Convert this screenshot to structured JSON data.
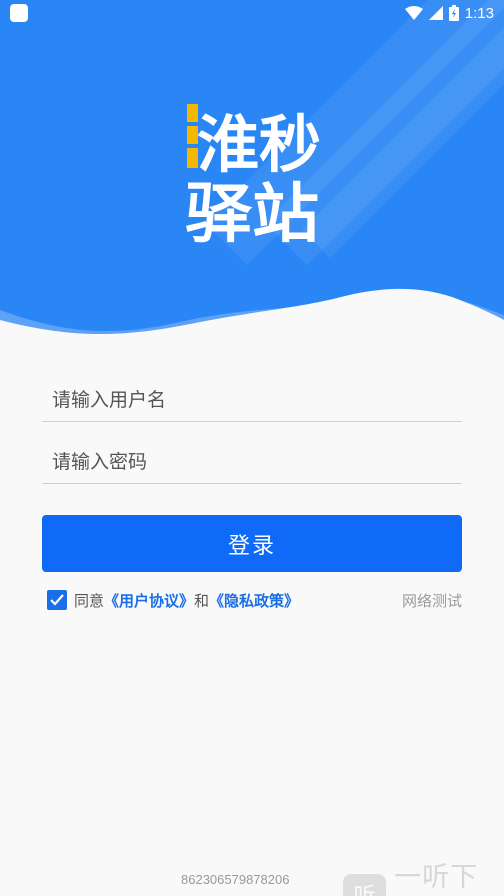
{
  "status_bar": {
    "time": "1:13",
    "icons": [
      "app-icon",
      "wifi-icon",
      "signal-icon",
      "battery-icon"
    ]
  },
  "logo": {
    "text_line1": "淮秒",
    "text_line2": "驿站",
    "accent_color": "#f5b800"
  },
  "form": {
    "username_placeholder": "请输入用户名",
    "password_placeholder": "请输入密码",
    "username_value": "",
    "password_value": ""
  },
  "login_button": {
    "label": "登录"
  },
  "agreement": {
    "checked": true,
    "prefix": "同意",
    "user_agreement": "《用户协议》",
    "and": "和",
    "privacy_policy": "《隐私政策》"
  },
  "network_test": {
    "label": "网络测试"
  },
  "device_id": "862306579878206",
  "watermark": {
    "icon_char": "听",
    "text": "一听下载"
  },
  "colors": {
    "header_blue": "#2b86f5",
    "button_blue": "#0f6bf7",
    "link_blue": "#1a6fe8",
    "logo_yellow": "#f5b800"
  }
}
